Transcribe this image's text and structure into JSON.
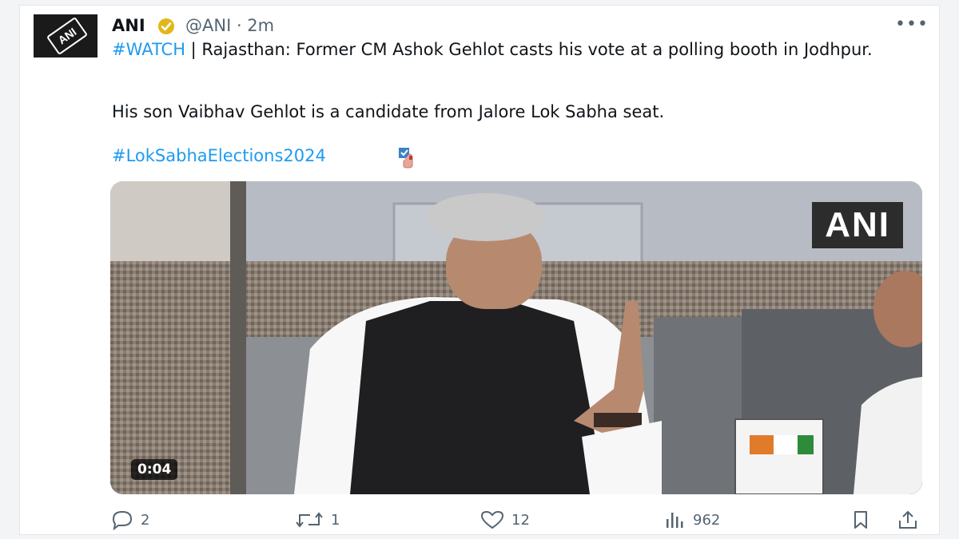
{
  "post": {
    "author_name": "ANI",
    "handle_time": "@ANI · 2m",
    "avatar_logo": "ANI",
    "more_label": "•••",
    "text_hashtag": "#WATCH",
    "text_line1": " | Rajasthan: Former CM Ashok Gehlot casts his vote at a polling booth in Jodhpur.",
    "text_line2": "His son Vaibhav Gehlot is a candidate from Jalore Lok Sabha seat.",
    "text_line3": "#LokSabhaElections2024"
  },
  "media": {
    "watermark": "ANI",
    "duration": "0:04"
  },
  "actions": {
    "replies": "2",
    "reposts": "1",
    "likes": "12",
    "views": "962"
  },
  "colors": {
    "accent": "#1d9bf0",
    "text": "#0f1419",
    "muted": "#536471",
    "verified": "#e2b719"
  }
}
